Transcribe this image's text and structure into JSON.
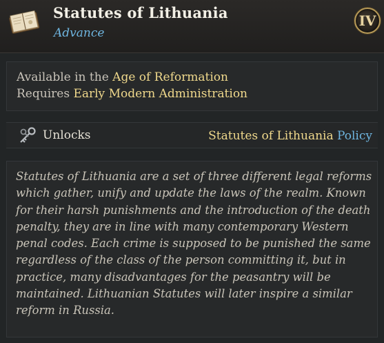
{
  "header": {
    "title": "Statutes of Lithuania",
    "subtitle": "Advance",
    "tier": "IV",
    "icon": "book-icon",
    "tier_badge_icon": "roman-numeral-badge"
  },
  "requirements": {
    "line1_prefix": "Available in the",
    "line1_value": "Age of Reformation",
    "line2_prefix": "Requires",
    "line2_value": "Early Modern Administration"
  },
  "unlocks": {
    "label": "Unlocks",
    "icon": "key-icon",
    "value": "Statutes of Lithuania",
    "value_type": "Policy"
  },
  "description": {
    "lines": [
      "Statutes of Lithuania are a set of three different legal reforms",
      "which gather, unify and update the laws of the realm. Known",
      "for their harsh punishments and the introduction of the death",
      "penalty, they are in line with many contemporary Western",
      "penal codes. Each crime is supposed to be punished the same",
      "regardless of the class of the person committing it, but in",
      "practice, many disadvantages for the peasantry will be",
      "maintained. Lithuanian Statutes will later inspire a similar",
      "reform in Russia."
    ]
  },
  "colors": {
    "highlight": "#f0d98c",
    "link_blue": "#6fb6e0",
    "body_text": "#c9c4b8",
    "panel": "#27292a"
  }
}
